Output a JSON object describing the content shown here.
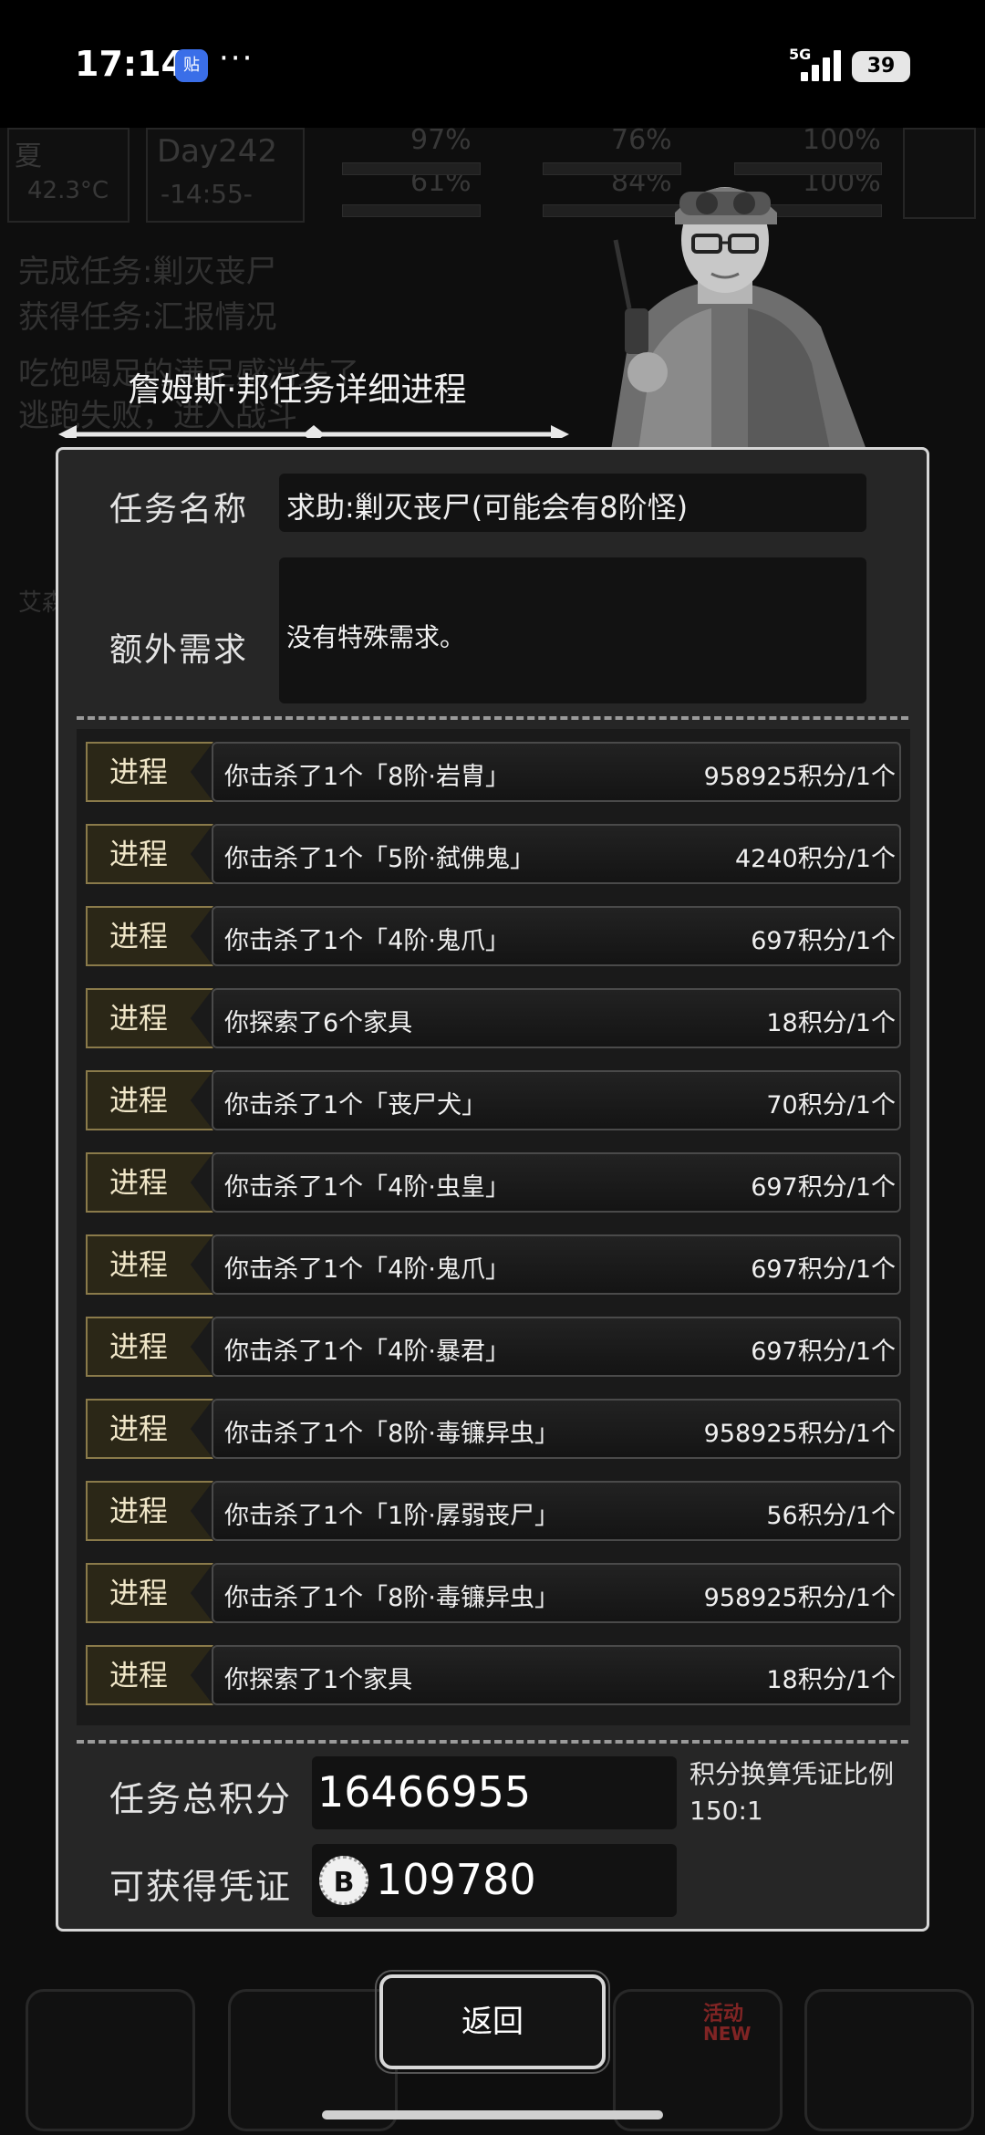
{
  "status_bar": {
    "time": "17:14",
    "app_badge": "贴",
    "more": "···",
    "network": "5G",
    "battery": "39"
  },
  "background_hud": {
    "season": "夏",
    "temperature": "42.3°C",
    "day": "Day242",
    "clock": "-14:55-",
    "stats": [
      "97%",
      "76%",
      "100%",
      "61%",
      "84%",
      "100%"
    ],
    "log_lines": [
      "完成任务:剿灭丧尸",
      "获得任务:汇报情况",
      "吃饱喝足的满足感消失了",
      "逃跑失败，进入战斗"
    ],
    "side_label": "艾森"
  },
  "dialog": {
    "title": "詹姆斯·邦任务详细进程",
    "task_name_label": "任务名称",
    "task_name_value": "求助:剿灭丧尸(可能会有8阶怪)",
    "extra_req_label": "额外需求",
    "extra_req_value": "没有特殊需求。",
    "progress_tag": "进程",
    "progress": [
      {
        "text": "你击杀了1个「8阶·岩胄」",
        "points": "958925积分/1个"
      },
      {
        "text": "你击杀了1个「5阶·弑佛鬼」",
        "points": "4240积分/1个"
      },
      {
        "text": "你击杀了1个「4阶·鬼爪」",
        "points": "697积分/1个"
      },
      {
        "text": "你探索了6个家具",
        "points": "18积分/1个"
      },
      {
        "text": "你击杀了1个「丧尸犬」",
        "points": "70积分/1个"
      },
      {
        "text": "你击杀了1个「4阶·虫皇」",
        "points": "697积分/1个"
      },
      {
        "text": "你击杀了1个「4阶·鬼爪」",
        "points": "697积分/1个"
      },
      {
        "text": "你击杀了1个「4阶·暴君」",
        "points": "697积分/1个"
      },
      {
        "text": "你击杀了1个「8阶·毒镰异虫」",
        "points": "958925积分/1个"
      },
      {
        "text": "你击杀了1个「1阶·孱弱丧尸」",
        "points": "56积分/1个"
      },
      {
        "text": "你击杀了1个「8阶·毒镰异虫」",
        "points": "958925积分/1个"
      },
      {
        "text": "你探索了1个家具",
        "points": "18积分/1个"
      }
    ],
    "total_label": "任务总积分",
    "total_value": "16466955",
    "ratio_label": "积分换算凭证比例",
    "ratio_value": "150:1",
    "voucher_label": "可获得凭证",
    "voucher_coin": "B",
    "voucher_value": "109780"
  },
  "back_button": "返回",
  "bottom_badge": {
    "top": "活动",
    "bottom": "NEW"
  }
}
